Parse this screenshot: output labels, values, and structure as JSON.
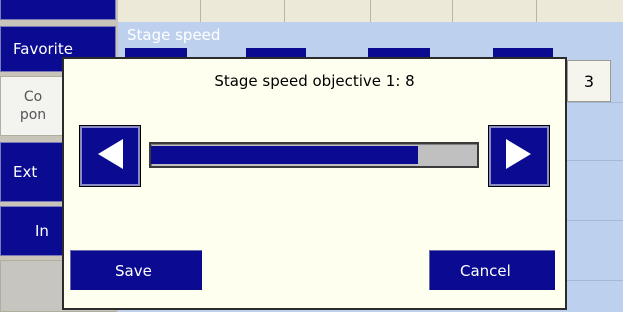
{
  "sidebar": {
    "items": [
      {
        "label": "Favorite"
      },
      {
        "label": "Co\npon"
      },
      {
        "label": "Ext"
      },
      {
        "label": "In"
      }
    ]
  },
  "panel": {
    "title": "Stage speed",
    "visible_value": "3"
  },
  "dialog": {
    "title": "Stage speed objective 1: 8",
    "slider_value_fraction": 0.82,
    "save_label": "Save",
    "cancel_label": "Cancel",
    "left_arrow_icon": "triangle-left-icon",
    "right_arrow_icon": "triangle-right-icon"
  },
  "colors": {
    "accent": "#0a0b91",
    "dialog_bg": "#fffff0",
    "panel_bg": "#bdd0ee"
  }
}
